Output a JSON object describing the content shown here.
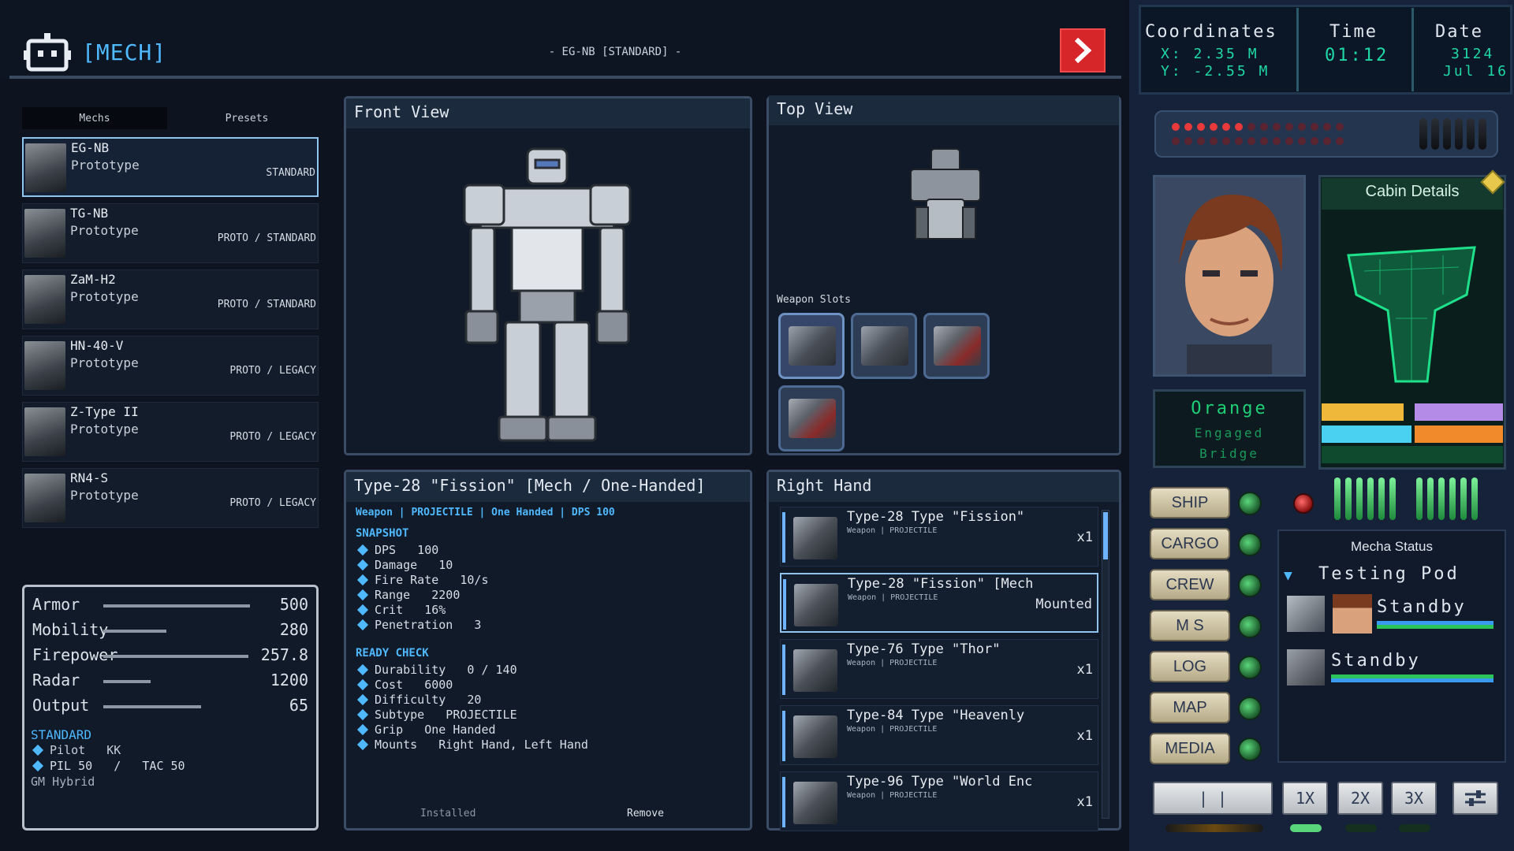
{
  "header": {
    "title": "[MECH]",
    "config_name": "- EG-NB [STANDARD] -"
  },
  "tabs": [
    "Mechs",
    "Presets"
  ],
  "mechs": [
    {
      "name": "EG-NB",
      "subtitle": "Prototype",
      "tag": "STANDARD"
    },
    {
      "name": "TG-NB",
      "subtitle": "Prototype",
      "tag": "PROTO / STANDARD"
    },
    {
      "name": "ZaM-H2",
      "subtitle": "Prototype",
      "tag": "PROTO / STANDARD"
    },
    {
      "name": "HN-40-V",
      "subtitle": "Prototype",
      "tag": "PROTO / LEGACY"
    },
    {
      "name": "Z-Type II",
      "subtitle": "Prototype",
      "tag": "PROTO / LEGACY"
    },
    {
      "name": "RN4-S",
      "subtitle": "Prototype",
      "tag": "PROTO / LEGACY"
    }
  ],
  "stats": [
    {
      "label": "Armor",
      "value": "500",
      "bar_fraction": 0.93
    },
    {
      "label": "Mobility",
      "value": "280",
      "bar_fraction": 0.4
    },
    {
      "label": "Firepower",
      "value": "257.8",
      "bar_fraction": 0.92
    },
    {
      "label": "Radar",
      "value": "1200",
      "bar_fraction": 0.3
    },
    {
      "label": "Output",
      "value": "65",
      "bar_fraction": 0.62
    }
  ],
  "loadout": {
    "type": "STANDARD",
    "pilot": "Pilot   KK",
    "pil_tac": "PIL 50   /   TAC 50",
    "hybrid": "GM Hybrid"
  },
  "front_view": {
    "title": "Front View"
  },
  "top_view": {
    "title": "Top View",
    "weapon_slots_label": "Weapon Slots"
  },
  "detail": {
    "title": "Type-28 \"Fission\" [Mech / One-Handed]",
    "tags": "Weapon | PROJECTILE | One Handed | DPS 100",
    "snapshot_label": "SNAPSHOT",
    "snapshot": [
      "DPS   100",
      "Damage   10",
      "Fire Rate   10/s",
      "Range   2200",
      "Crit   16%",
      "Penetration   3"
    ],
    "ready_label": "READY CHECK",
    "ready": [
      "Durability   0 / 140",
      "Cost   6000",
      "Difficulty   20",
      "Subtype   PROJECTILE",
      "Grip   One Handed",
      "Mounts   Right Hand, Left Hand"
    ],
    "installed": "Installed",
    "remove": "Remove"
  },
  "right_hand": {
    "title": "Right Hand",
    "items": [
      {
        "name": "Type-28 Type \"Fission\"",
        "sub": "Weapon | PROJECTILE",
        "qty": "x1"
      },
      {
        "name": "Type-28 \"Fission\" [Mech",
        "sub": "Weapon | PROJECTILE",
        "qty": "Mounted"
      },
      {
        "name": "Type-76 Type \"Thor\"",
        "sub": "Weapon | PROJECTILE",
        "qty": "x1"
      },
      {
        "name": "Type-84 Type \"Heavenly",
        "sub": "Weapon | PROJECTILE",
        "qty": "x1"
      },
      {
        "name": "Type-96 Type \"World Enc",
        "sub": "Weapon | PROJECTILE",
        "qty": "x1"
      }
    ]
  },
  "hud": {
    "coordinates_label": "Coordinates",
    "x": "X:  2.35 M",
    "y": "Y: -2.55 M",
    "time_label": "Time",
    "time": "01:12",
    "date_label": "Date",
    "year": "3124",
    "day": "Jul 16"
  },
  "pilot_panel": {
    "name": "Orange",
    "status": "Engaged",
    "location": "Bridge"
  },
  "cabin": {
    "title": "Cabin Details"
  },
  "nav_buttons": [
    "SHIP",
    "CARGO",
    "CREW",
    "M S",
    "LOG",
    "MAP",
    "MEDIA"
  ],
  "mecha_status": {
    "title": "Mecha Status",
    "group": "Testing Pod",
    "units": [
      {
        "state": "Standby"
      },
      {
        "state": "Standby"
      }
    ]
  },
  "speed": {
    "pause": "| |",
    "options": [
      "1X",
      "2X",
      "3X"
    ]
  },
  "colors": {
    "accent": "#4fb8ff",
    "red_button": "#d6262a",
    "hud_green": "#1fd8a6"
  }
}
